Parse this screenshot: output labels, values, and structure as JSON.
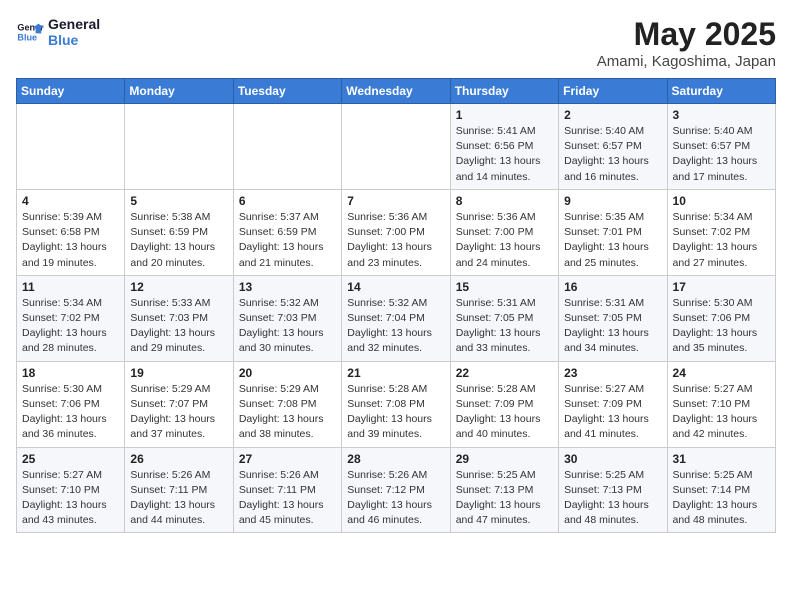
{
  "header": {
    "logo_line1": "General",
    "logo_line2": "Blue",
    "month": "May 2025",
    "location": "Amami, Kagoshima, Japan"
  },
  "weekdays": [
    "Sunday",
    "Monday",
    "Tuesday",
    "Wednesday",
    "Thursday",
    "Friday",
    "Saturday"
  ],
  "weeks": [
    [
      {
        "day": "",
        "info": ""
      },
      {
        "day": "",
        "info": ""
      },
      {
        "day": "",
        "info": ""
      },
      {
        "day": "",
        "info": ""
      },
      {
        "day": "1",
        "info": "Sunrise: 5:41 AM\nSunset: 6:56 PM\nDaylight: 13 hours\nand 14 minutes."
      },
      {
        "day": "2",
        "info": "Sunrise: 5:40 AM\nSunset: 6:57 PM\nDaylight: 13 hours\nand 16 minutes."
      },
      {
        "day": "3",
        "info": "Sunrise: 5:40 AM\nSunset: 6:57 PM\nDaylight: 13 hours\nand 17 minutes."
      }
    ],
    [
      {
        "day": "4",
        "info": "Sunrise: 5:39 AM\nSunset: 6:58 PM\nDaylight: 13 hours\nand 19 minutes."
      },
      {
        "day": "5",
        "info": "Sunrise: 5:38 AM\nSunset: 6:59 PM\nDaylight: 13 hours\nand 20 minutes."
      },
      {
        "day": "6",
        "info": "Sunrise: 5:37 AM\nSunset: 6:59 PM\nDaylight: 13 hours\nand 21 minutes."
      },
      {
        "day": "7",
        "info": "Sunrise: 5:36 AM\nSunset: 7:00 PM\nDaylight: 13 hours\nand 23 minutes."
      },
      {
        "day": "8",
        "info": "Sunrise: 5:36 AM\nSunset: 7:00 PM\nDaylight: 13 hours\nand 24 minutes."
      },
      {
        "day": "9",
        "info": "Sunrise: 5:35 AM\nSunset: 7:01 PM\nDaylight: 13 hours\nand 25 minutes."
      },
      {
        "day": "10",
        "info": "Sunrise: 5:34 AM\nSunset: 7:02 PM\nDaylight: 13 hours\nand 27 minutes."
      }
    ],
    [
      {
        "day": "11",
        "info": "Sunrise: 5:34 AM\nSunset: 7:02 PM\nDaylight: 13 hours\nand 28 minutes."
      },
      {
        "day": "12",
        "info": "Sunrise: 5:33 AM\nSunset: 7:03 PM\nDaylight: 13 hours\nand 29 minutes."
      },
      {
        "day": "13",
        "info": "Sunrise: 5:32 AM\nSunset: 7:03 PM\nDaylight: 13 hours\nand 30 minutes."
      },
      {
        "day": "14",
        "info": "Sunrise: 5:32 AM\nSunset: 7:04 PM\nDaylight: 13 hours\nand 32 minutes."
      },
      {
        "day": "15",
        "info": "Sunrise: 5:31 AM\nSunset: 7:05 PM\nDaylight: 13 hours\nand 33 minutes."
      },
      {
        "day": "16",
        "info": "Sunrise: 5:31 AM\nSunset: 7:05 PM\nDaylight: 13 hours\nand 34 minutes."
      },
      {
        "day": "17",
        "info": "Sunrise: 5:30 AM\nSunset: 7:06 PM\nDaylight: 13 hours\nand 35 minutes."
      }
    ],
    [
      {
        "day": "18",
        "info": "Sunrise: 5:30 AM\nSunset: 7:06 PM\nDaylight: 13 hours\nand 36 minutes."
      },
      {
        "day": "19",
        "info": "Sunrise: 5:29 AM\nSunset: 7:07 PM\nDaylight: 13 hours\nand 37 minutes."
      },
      {
        "day": "20",
        "info": "Sunrise: 5:29 AM\nSunset: 7:08 PM\nDaylight: 13 hours\nand 38 minutes."
      },
      {
        "day": "21",
        "info": "Sunrise: 5:28 AM\nSunset: 7:08 PM\nDaylight: 13 hours\nand 39 minutes."
      },
      {
        "day": "22",
        "info": "Sunrise: 5:28 AM\nSunset: 7:09 PM\nDaylight: 13 hours\nand 40 minutes."
      },
      {
        "day": "23",
        "info": "Sunrise: 5:27 AM\nSunset: 7:09 PM\nDaylight: 13 hours\nand 41 minutes."
      },
      {
        "day": "24",
        "info": "Sunrise: 5:27 AM\nSunset: 7:10 PM\nDaylight: 13 hours\nand 42 minutes."
      }
    ],
    [
      {
        "day": "25",
        "info": "Sunrise: 5:27 AM\nSunset: 7:10 PM\nDaylight: 13 hours\nand 43 minutes."
      },
      {
        "day": "26",
        "info": "Sunrise: 5:26 AM\nSunset: 7:11 PM\nDaylight: 13 hours\nand 44 minutes."
      },
      {
        "day": "27",
        "info": "Sunrise: 5:26 AM\nSunset: 7:11 PM\nDaylight: 13 hours\nand 45 minutes."
      },
      {
        "day": "28",
        "info": "Sunrise: 5:26 AM\nSunset: 7:12 PM\nDaylight: 13 hours\nand 46 minutes."
      },
      {
        "day": "29",
        "info": "Sunrise: 5:25 AM\nSunset: 7:13 PM\nDaylight: 13 hours\nand 47 minutes."
      },
      {
        "day": "30",
        "info": "Sunrise: 5:25 AM\nSunset: 7:13 PM\nDaylight: 13 hours\nand 48 minutes."
      },
      {
        "day": "31",
        "info": "Sunrise: 5:25 AM\nSunset: 7:14 PM\nDaylight: 13 hours\nand 48 minutes."
      }
    ]
  ]
}
